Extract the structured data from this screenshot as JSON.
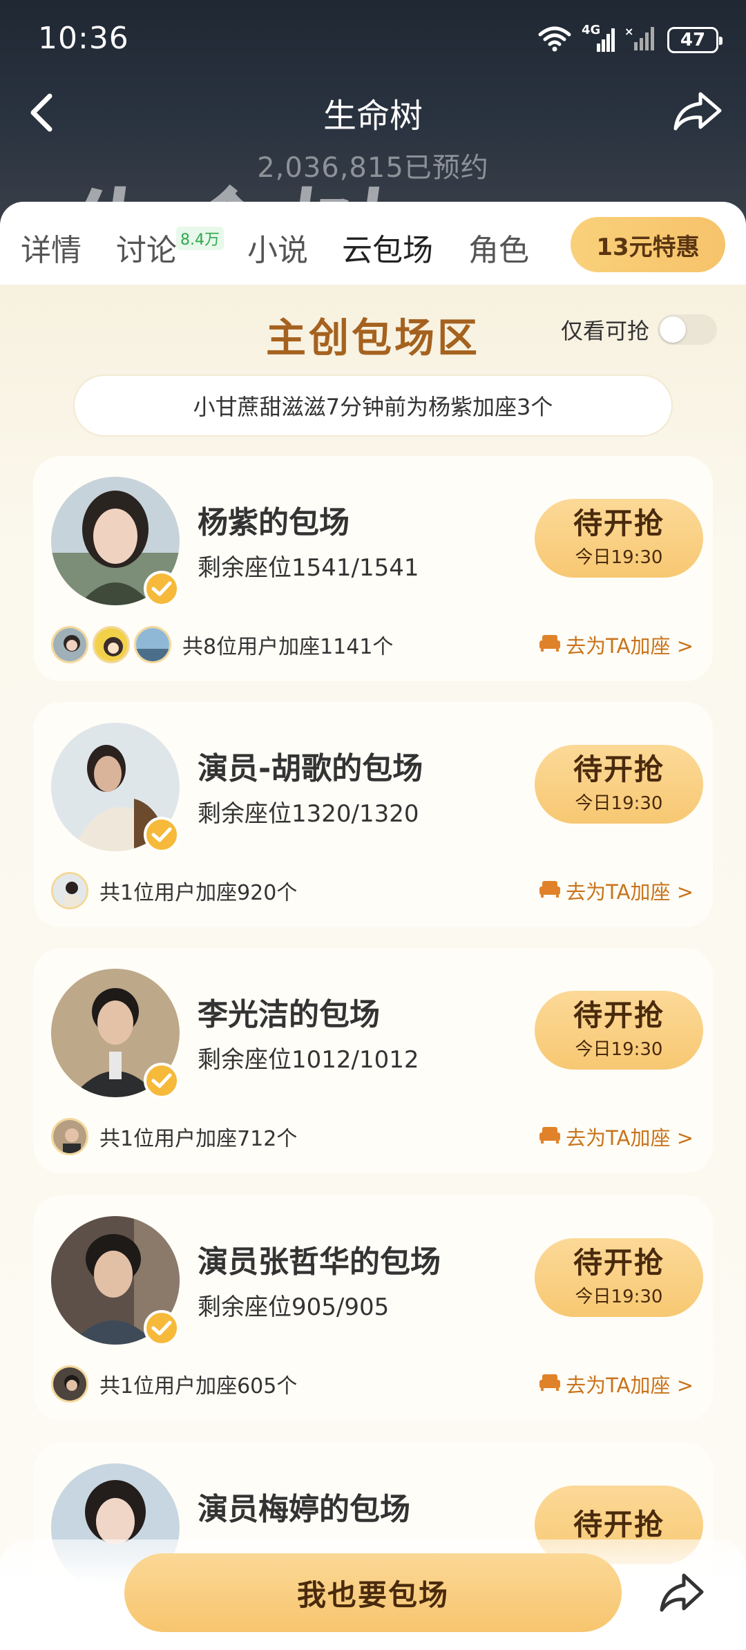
{
  "status_bar": {
    "time": "10:36",
    "network": "4G",
    "battery": "47"
  },
  "nav": {
    "title": "生命树",
    "reserve_count": "2,036,815已预约",
    "ghost_title": "生命树"
  },
  "tabs": [
    {
      "label": "详情"
    },
    {
      "label": "讨论",
      "badge": "8.4万"
    },
    {
      "label": "小说"
    },
    {
      "label": "云包场"
    },
    {
      "label": "角色"
    }
  ],
  "promo": {
    "label": "13元特惠"
  },
  "section": {
    "title": "主创包场区",
    "filter_label": "仅看可抢",
    "notice": "小甘蔗甜滋滋7分钟前为杨紫加座3个"
  },
  "cards": [
    {
      "title": "杨紫的包场",
      "seats": "剩余座位1541/1541",
      "btn_main": "待开抢",
      "btn_sub": "今日19:30",
      "joiners": "共8位用户加座1141个",
      "join_link": "去为TA加座 >"
    },
    {
      "title": "演员-胡歌的包场",
      "seats": "剩余座位1320/1320",
      "btn_main": "待开抢",
      "btn_sub": "今日19:30",
      "joiners": "共1位用户加座920个",
      "join_link": "去为TA加座 >"
    },
    {
      "title": "李光洁的包场",
      "seats": "剩余座位1012/1012",
      "btn_main": "待开抢",
      "btn_sub": "今日19:30",
      "joiners": "共1位用户加座712个",
      "join_link": "去为TA加座 >"
    },
    {
      "title": "演员张哲华的包场",
      "seats": "剩余座位905/905",
      "btn_main": "待开抢",
      "btn_sub": "今日19:30",
      "joiners": "共1位用户加座605个",
      "join_link": "去为TA加座 >"
    },
    {
      "title": "演员梅婷的包场",
      "btn_main": "待开抢"
    }
  ],
  "bottom": {
    "button_label": "我也要包场"
  },
  "colors": {
    "accent": "#f7c872",
    "section_title": "#a5621f",
    "link": "#c8741c",
    "header_bg": "#1f2833"
  },
  "icons": [
    "back-arrow-icon",
    "share-icon",
    "wifi-icon",
    "signal-icon",
    "battery-icon",
    "verified-icon",
    "sofa-icon"
  ]
}
